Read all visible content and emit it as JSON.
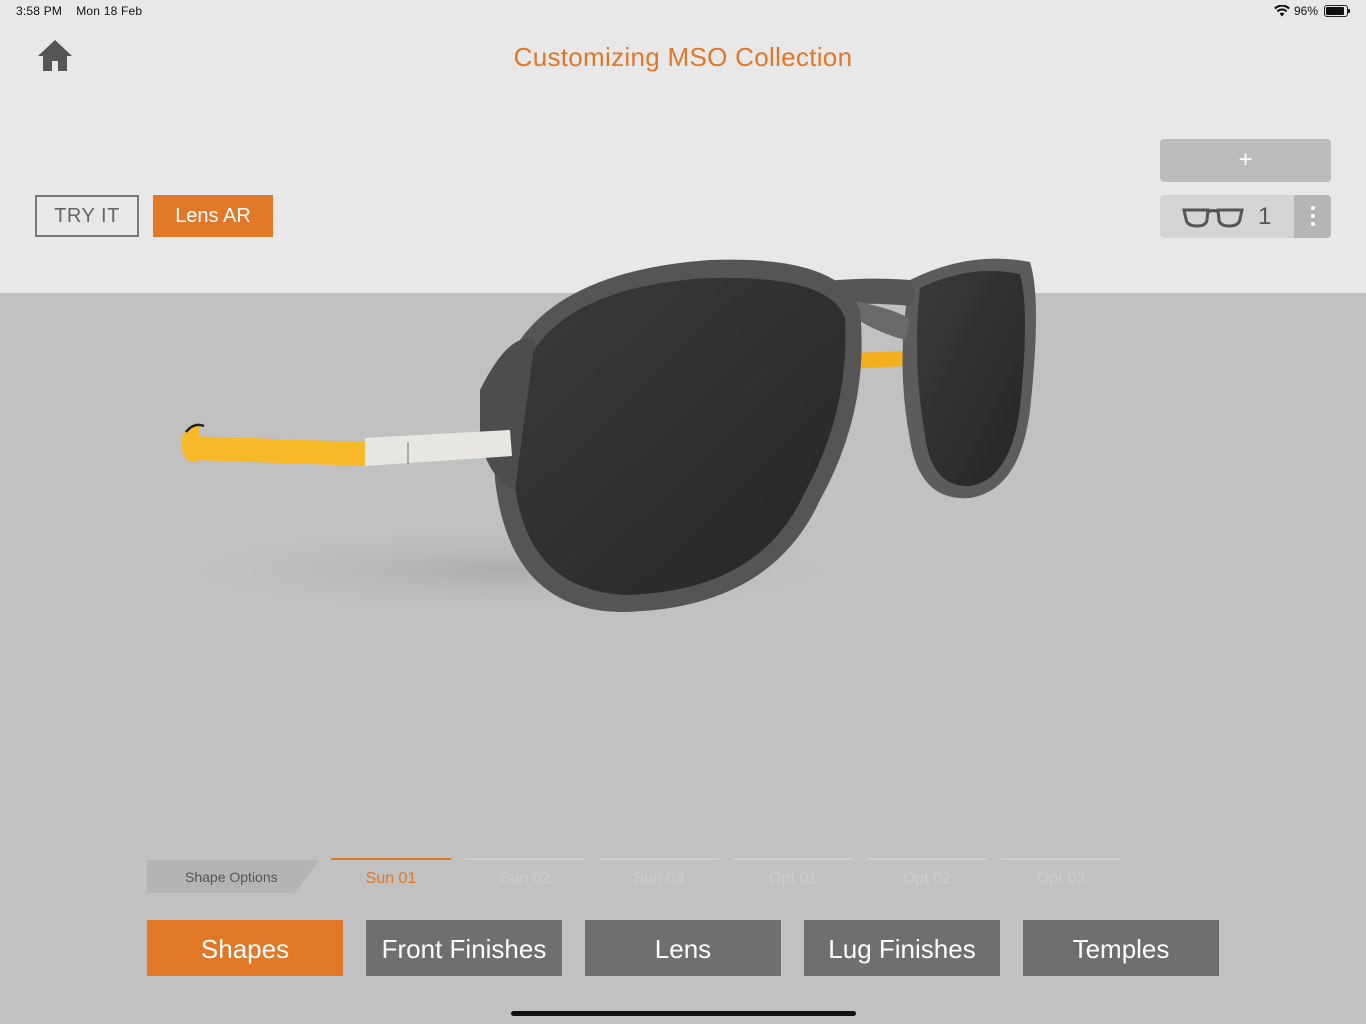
{
  "status_bar": {
    "time": "3:58 PM",
    "date": "Mon 18 Feb",
    "battery": "96%",
    "icons": [
      "wifi-icon",
      "battery-icon"
    ]
  },
  "header": {
    "title": "Customizing MSO Collection",
    "home_icon": "home-icon"
  },
  "actions": {
    "try_it": "TRY IT",
    "lens_ar": "Lens AR",
    "add_label": "+",
    "saved_count": "1",
    "glasses_icon": "glasses-icon",
    "more_icon": "more-vertical-icon"
  },
  "sub_tabs": {
    "section_label": "Shape Options",
    "items": [
      {
        "label": "Sun 01",
        "active": true
      },
      {
        "label": "Sun 02",
        "active": false
      },
      {
        "label": "Sun 03",
        "active": false
      },
      {
        "label": "Opt 01",
        "active": false
      },
      {
        "label": "Opt 02",
        "active": false
      },
      {
        "label": "Opt 03",
        "active": false
      }
    ]
  },
  "main_tabs": [
    {
      "label": "Shapes",
      "active": true
    },
    {
      "label": "Front Finishes",
      "active": false
    },
    {
      "label": "Lens",
      "active": false
    },
    {
      "label": "Lug Finishes",
      "active": false
    },
    {
      "label": "Temples",
      "active": false
    }
  ],
  "colors": {
    "accent": "#e07828",
    "tab_inactive": "#6f6f6f",
    "temple_yellow": "#f7b928",
    "frame_gray": "#555555",
    "lens_dark": "#2a2a2a"
  }
}
